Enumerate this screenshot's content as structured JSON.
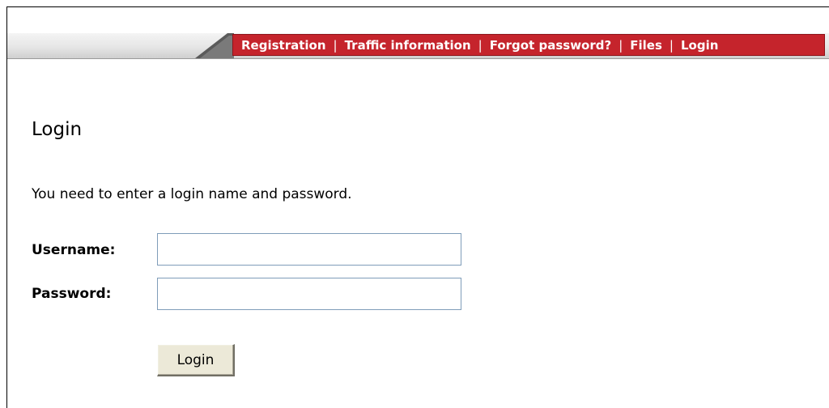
{
  "nav": {
    "items": [
      {
        "label": "Registration"
      },
      {
        "label": "Traffic information"
      },
      {
        "label": "Forgot password?"
      },
      {
        "label": "Files"
      },
      {
        "label": "Login"
      }
    ],
    "separator": "|"
  },
  "page": {
    "title": "Login",
    "instructions": "You need to enter a login name and password."
  },
  "form": {
    "username_label": "Username:",
    "username_value": "",
    "password_label": "Password:",
    "password_value": "",
    "submit_label": "Login"
  },
  "colors": {
    "nav_background": "#c5242c",
    "nav_text": "#ffffff",
    "input_border": "#7f9db9",
    "button_face": "#ece9d8"
  }
}
